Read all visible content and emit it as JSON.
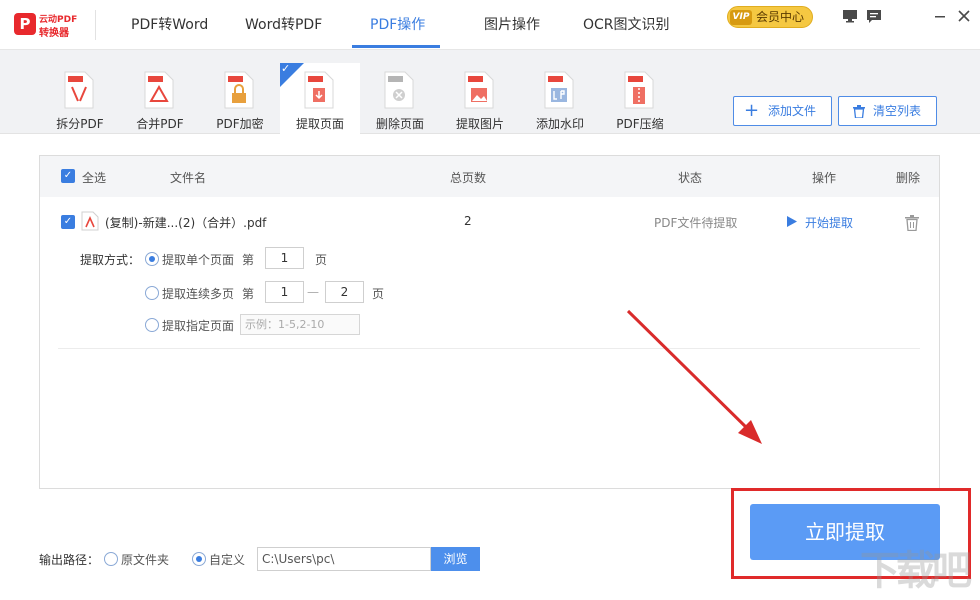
{
  "app": {
    "logo_line1": "云动PDF",
    "logo_line2": "转换器",
    "logo_mark": "P"
  },
  "nav": {
    "tabs": [
      {
        "label": "PDF转Word"
      },
      {
        "label": "Word转PDF"
      },
      {
        "label": "PDF操作"
      },
      {
        "label": "图片操作"
      },
      {
        "label": "OCR图文识别"
      }
    ],
    "active_index": 2,
    "vip_badge": "VIP",
    "vip_label": "会员中心"
  },
  "toolbar": {
    "tools": [
      {
        "label": "拆分PDF",
        "icon": "split-pdf-icon"
      },
      {
        "label": "合并PDF",
        "icon": "merge-pdf-icon"
      },
      {
        "label": "PDF加密",
        "icon": "encrypt-pdf-icon"
      },
      {
        "label": "提取页面",
        "icon": "extract-page-icon"
      },
      {
        "label": "删除页面",
        "icon": "delete-page-icon"
      },
      {
        "label": "提取图片",
        "icon": "extract-image-icon"
      },
      {
        "label": "添加水印",
        "icon": "watermark-icon"
      },
      {
        "label": "PDF压缩",
        "icon": "compress-pdf-icon"
      }
    ],
    "active_index": 3,
    "add_file_label": "添加文件",
    "clear_list_label": "清空列表"
  },
  "table": {
    "headers": {
      "select_all": "全选",
      "filename": "文件名",
      "pages": "总页数",
      "status": "状态",
      "action": "操作",
      "delete": "删除"
    },
    "rows": [
      {
        "filename": "(复制)-新建...(2)（合并）.pdf",
        "pages": "2",
        "status": "PDF文件待提取",
        "action": "开始提取"
      }
    ],
    "extract": {
      "mode_label": "提取方式：",
      "options": [
        {
          "label": "提取单个页面",
          "selected": true
        },
        {
          "label": "提取连续多页",
          "selected": false
        },
        {
          "label": "提取指定页面",
          "selected": false
        }
      ],
      "page_prefix": "第",
      "page_suffix": "页",
      "single_page": "1",
      "range_from": "1",
      "range_to": "2",
      "range_dash": "—",
      "specific_placeholder": "示例：1-5,2-10"
    }
  },
  "output": {
    "label": "输出路径：",
    "option_original": "原文件夹",
    "option_custom": "自定义",
    "selected": "自定义",
    "path": "C:\\Users\\pc\\",
    "browse_label": "浏览"
  },
  "primary_action": {
    "label": "立即提取"
  },
  "watermark_text": "下载吧",
  "colors": {
    "accent": "#3a7de0",
    "primary_button": "#5b9bf5",
    "annotation_red": "#e02a2a",
    "vip_gold": "#f5c842"
  }
}
